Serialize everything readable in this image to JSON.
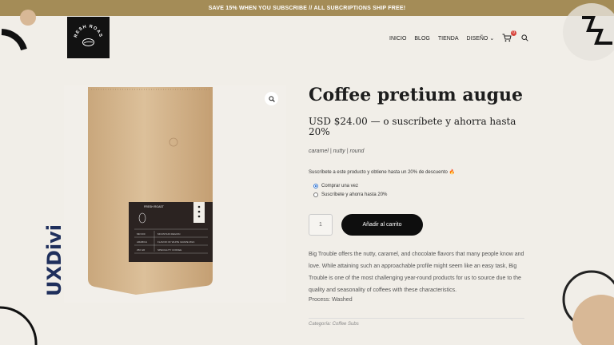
{
  "topbar": {
    "text": "SAVE 15% WHEN YOU SUBSCRIBE // ALL SUBCRIPTIONS SHIP FREE!"
  },
  "nav": {
    "items": [
      "INICIO",
      "BLOG",
      "TIENDA",
      "DISEÑO"
    ],
    "cart_count": "0"
  },
  "logo": {
    "text": "FRESH ROAST"
  },
  "product": {
    "title": "Coffee pretium augue",
    "price": "USD $24.00 — o suscríbete y ahorra hasta 20%",
    "tags": "caramel | nutty | round",
    "subscribe_note": "Suscríbete a este producto y obtiene hasta un 20% de descuento 🔥",
    "options": [
      "Comprar una vez",
      "Suscríbete y ahorra hasta  20%"
    ],
    "quantity": "1",
    "add_to_cart": "Añadir al carrito",
    "description": "Big Trouble offers the nutty, caramel, and chocolate flavors that many people know and love. While attaining such an approachable profile might seem like an easy task, Big Trouble is one of the most challenging year-round products for us to source due to the quality and seasonality of coffees with these characteristics.",
    "process": "Process: Washed",
    "category": "Categoría: Coffee Subs"
  },
  "bag_label": {
    "brand": "FRESH ROAST",
    "rows": [
      [
        "MR 000",
        "MOUNTAIN REGION"
      ],
      [
        "ARABICA",
        "FLAVOR OF WHITE GRAPE MILK"
      ],
      [
        "250 GR",
        "SPECIALITY COFFEE"
      ]
    ]
  },
  "watermark": {
    "text": "UXDivi"
  },
  "colors": {
    "topbar": "#a48c57",
    "background": "#f1eee8",
    "button": "#0e0e0e",
    "badge": "#d8443b"
  }
}
